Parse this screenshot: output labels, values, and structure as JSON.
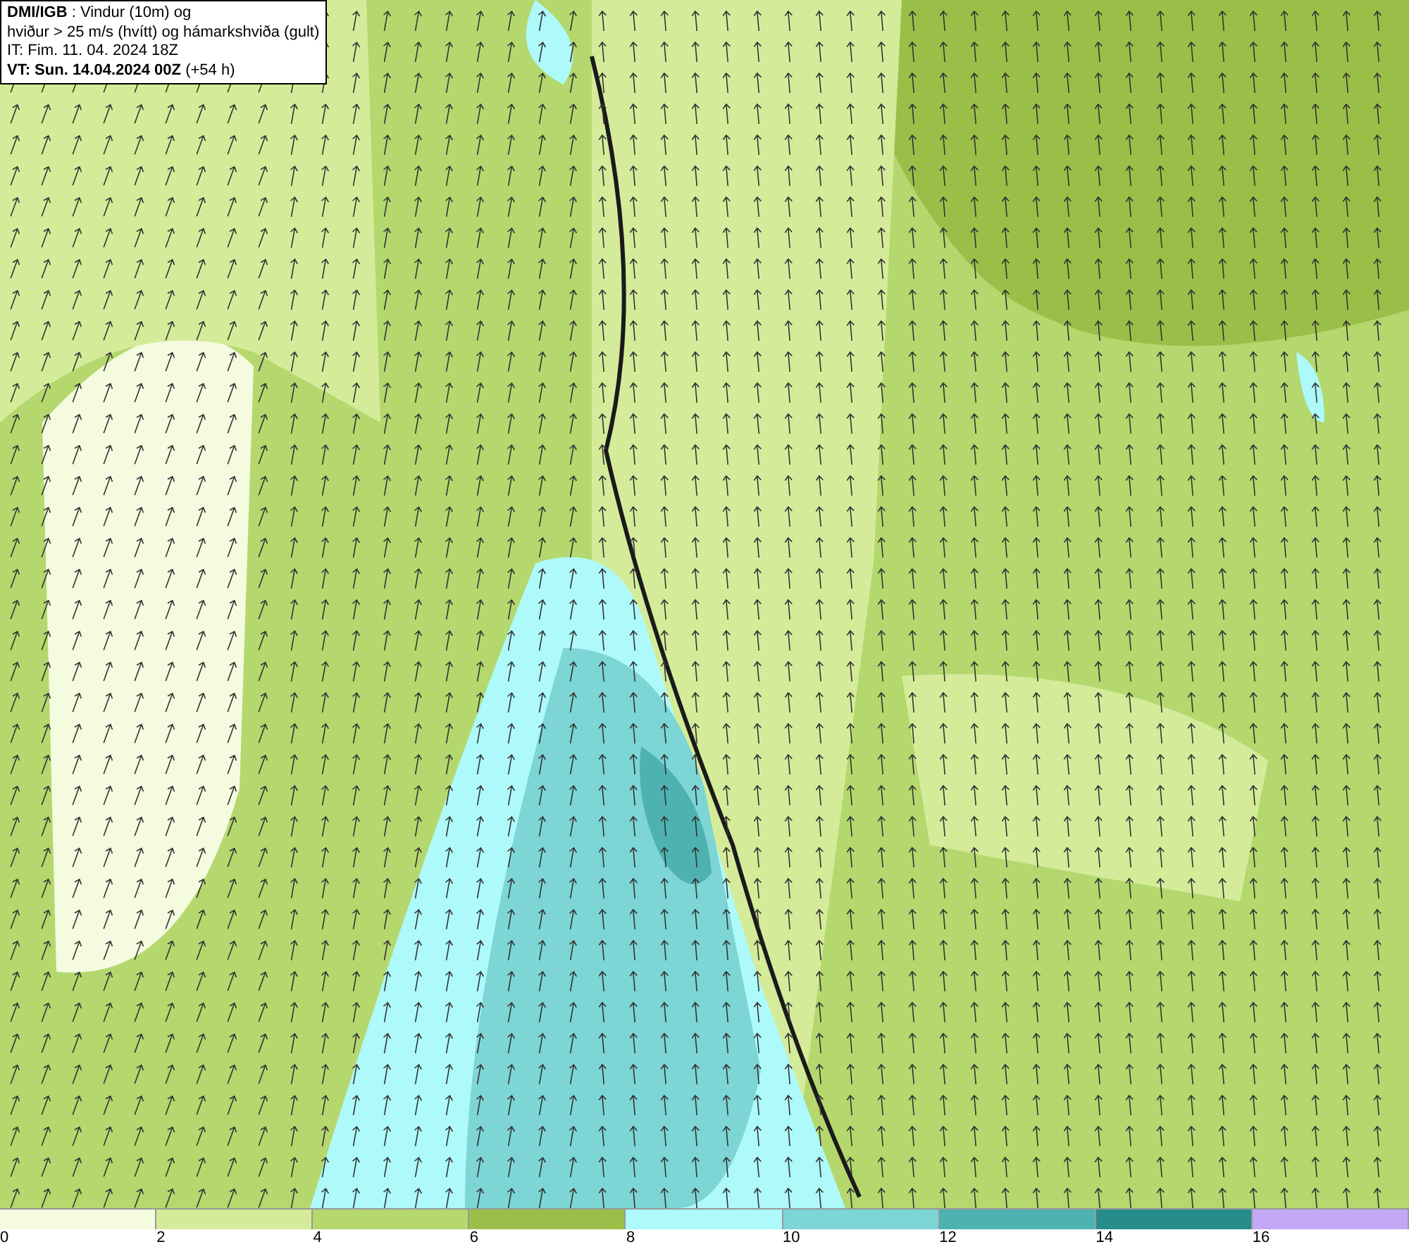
{
  "header": {
    "lines": [
      "**DMI/IGB** : Vindur (10m) og",
      "hviður > 25 m/s (hvítt) og hámarkshviða (gult)",
      "IT: Fim. 11. 04. 2024 18Z",
      "**VT: Sun. 14.04.2024 00Z** (+54 h)"
    ]
  },
  "legend": {
    "items": [
      {
        "color": "#f4fbdf",
        "label": "0"
      },
      {
        "color": "#d4ec9a",
        "label": "2"
      },
      {
        "color": "#b4d86e",
        "label": "4"
      },
      {
        "color": "#9abf48",
        "label": "6"
      },
      {
        "color": "#aef9fa",
        "label": "8"
      },
      {
        "color": "#7dd5d5",
        "label": "10"
      },
      {
        "color": "#4fb2b2",
        "label": "12"
      },
      {
        "color": "#268c8c",
        "label": "14"
      },
      {
        "color": "#c2a8f5",
        "label": "16"
      }
    ]
  }
}
